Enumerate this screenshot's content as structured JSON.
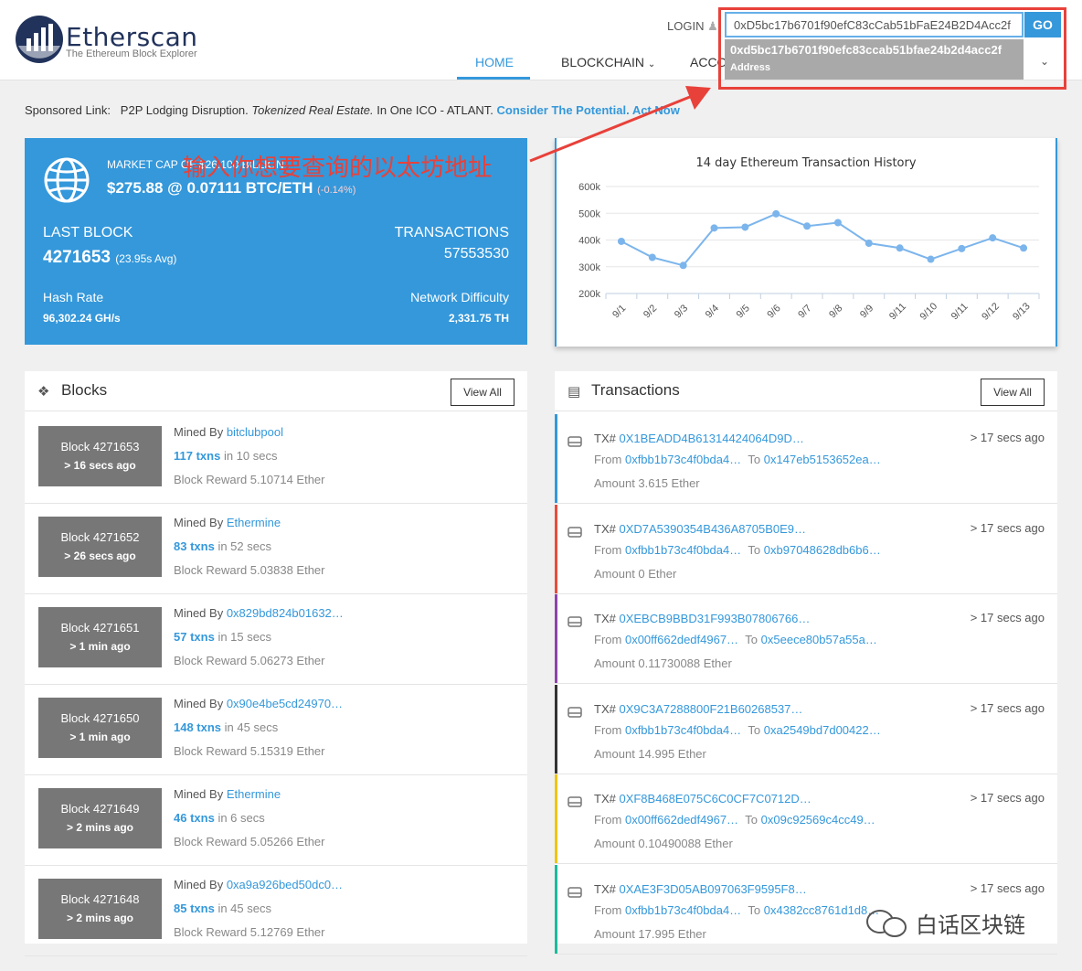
{
  "header": {
    "brand": "Etherscan",
    "tagline": "The Ethereum Block Explorer",
    "login": "LOGIN",
    "nav": [
      "HOME",
      "BLOCKCHAIN",
      "ACCO"
    ],
    "search_value": "0xD5bc17b6701f90efC83cCab51bFaE24B2D4Acc2f",
    "go": "GO",
    "suggestion_main": "0xd5bc17b6701f90efc83ccab51bfae24b2d4acc2f",
    "suggestion_sub": "Address"
  },
  "sponsored": {
    "label": "Sponsored Link:",
    "text1": "P2P Lodging Disruption.",
    "text2": "Tokenized Real Estate.",
    "text3": "In One ICO - ATLANT.",
    "link": "Consider The Potential. Act Now"
  },
  "annotation": "输入你想要查询的以太坊地址",
  "market": {
    "cap_label": "MARKET CAP OF $26.100 BILLION",
    "cap_value": "$275.88 @ 0.07111 BTC/ETH",
    "cap_change": "(-0.14%)",
    "last_block_label": "LAST BLOCK",
    "last_block_value": "4271653",
    "last_block_avg": "(23.95s Avg)",
    "transactions_label": "TRANSACTIONS",
    "transactions_value": "57553530",
    "hashrate_label": "Hash Rate",
    "hashrate_value": "96,302.24 GH/s",
    "difficulty_label": "Network Difficulty",
    "difficulty_value": "2,331.75 TH"
  },
  "chart_data": {
    "type": "line",
    "title": "14 day Ethereum Transaction History",
    "categories": [
      "9/1",
      "9/2",
      "9/3",
      "9/4",
      "9/5",
      "9/6",
      "9/7",
      "9/8",
      "9/9",
      "9/11",
      "9/10",
      "9/11",
      "9/12",
      "9/13"
    ],
    "values": [
      395000,
      335000,
      305000,
      445000,
      448000,
      498000,
      452000,
      465000,
      388000,
      370000,
      328000,
      368000,
      408000,
      370000
    ],
    "y_ticks": [
      "600k",
      "500k",
      "400k",
      "300k",
      "200k"
    ],
    "ylim": [
      200000,
      600000
    ],
    "grid": true,
    "color": "#7cb5ec"
  },
  "blocks": {
    "title": "Blocks",
    "view_all": "View All",
    "items": [
      {
        "block": "Block 4271653",
        "age": "> 16 secs ago",
        "mined_label": "Mined By",
        "miner": "bitclubpool",
        "txns": "117 txns",
        "time": "in 10 secs",
        "reward": "Block Reward 5.10714 Ether"
      },
      {
        "block": "Block 4271652",
        "age": "> 26 secs ago",
        "mined_label": "Mined By",
        "miner": "Ethermine",
        "txns": "83 txns",
        "time": "in 52 secs",
        "reward": "Block Reward 5.03838 Ether"
      },
      {
        "block": "Block 4271651",
        "age": "> 1 min ago",
        "mined_label": "Mined By",
        "miner": "0x829bd824b01632…",
        "txns": "57 txns",
        "time": "in 15 secs",
        "reward": "Block Reward 5.06273 Ether"
      },
      {
        "block": "Block 4271650",
        "age": "> 1 min ago",
        "mined_label": "Mined By",
        "miner": "0x90e4be5cd24970…",
        "txns": "148 txns",
        "time": "in 45 secs",
        "reward": "Block Reward 5.15319 Ether"
      },
      {
        "block": "Block 4271649",
        "age": "> 2 mins ago",
        "mined_label": "Mined By",
        "miner": "Ethermine",
        "txns": "46 txns",
        "time": "in 6 secs",
        "reward": "Block Reward 5.05266 Ether"
      },
      {
        "block": "Block 4271648",
        "age": "> 2 mins ago",
        "mined_label": "Mined By",
        "miner": "0xa9a926bed50dc0…",
        "txns": "85 txns",
        "time": "in 45 secs",
        "reward": "Block Reward 5.12769 Ether"
      }
    ]
  },
  "transactions": {
    "title": "Transactions",
    "view_all": "View All",
    "items": [
      {
        "tx_label": "TX#",
        "hash": "0X1BEADD4B61314424064D9D…",
        "age": "> 17 secs ago",
        "from_label": "From",
        "from": "0xfbb1b73c4f0bda4…",
        "to_label": "To",
        "to": "0x147eb5153652ea…",
        "amount": "Amount 3.615 Ether",
        "color": "#3498db"
      },
      {
        "tx_label": "TX#",
        "hash": "0XD7A5390354B436A8705B0E9…",
        "age": "> 17 secs ago",
        "from_label": "From",
        "from": "0xfbb1b73c4f0bda4…",
        "to_label": "To",
        "to": "0xb97048628db6b6…",
        "amount": "Amount 0 Ether",
        "color": "#e74c3c"
      },
      {
        "tx_label": "TX#",
        "hash": "0XEBCB9BBD31F993B07806766…",
        "age": "> 17 secs ago",
        "from_label": "From",
        "from": "0x00ff662dedf4967…",
        "to_label": "To",
        "to": "0x5eece80b57a55a…",
        "amount": "Amount 0.11730088 Ether",
        "color": "#8e44ad"
      },
      {
        "tx_label": "TX#",
        "hash": "0X9C3A7288800F21B60268537…",
        "age": "> 17 secs ago",
        "from_label": "From",
        "from": "0xfbb1b73c4f0bda4…",
        "to_label": "To",
        "to": "0xa2549bd7d00422…",
        "amount": "Amount 14.995 Ether",
        "color": "#333333"
      },
      {
        "tx_label": "TX#",
        "hash": "0XF8B468E075C6C0CF7C0712D…",
        "age": "> 17 secs ago",
        "from_label": "From",
        "from": "0x00ff662dedf4967…",
        "to_label": "To",
        "to": "0x09c92569c4cc49…",
        "amount": "Amount 0.10490088 Ether",
        "color": "#f1c40f"
      },
      {
        "tx_label": "TX#",
        "hash": "0XAE3F3D05AB097063F9595F8…",
        "age": "> 17 secs ago",
        "from_label": "From",
        "from": "0xfbb1b73c4f0bda4…",
        "to_label": "To",
        "to": "0x4382cc8761d1d8…",
        "amount": "Amount 17.995 Ether",
        "color": "#1abc9c"
      }
    ]
  },
  "watermark": "白话区块链"
}
